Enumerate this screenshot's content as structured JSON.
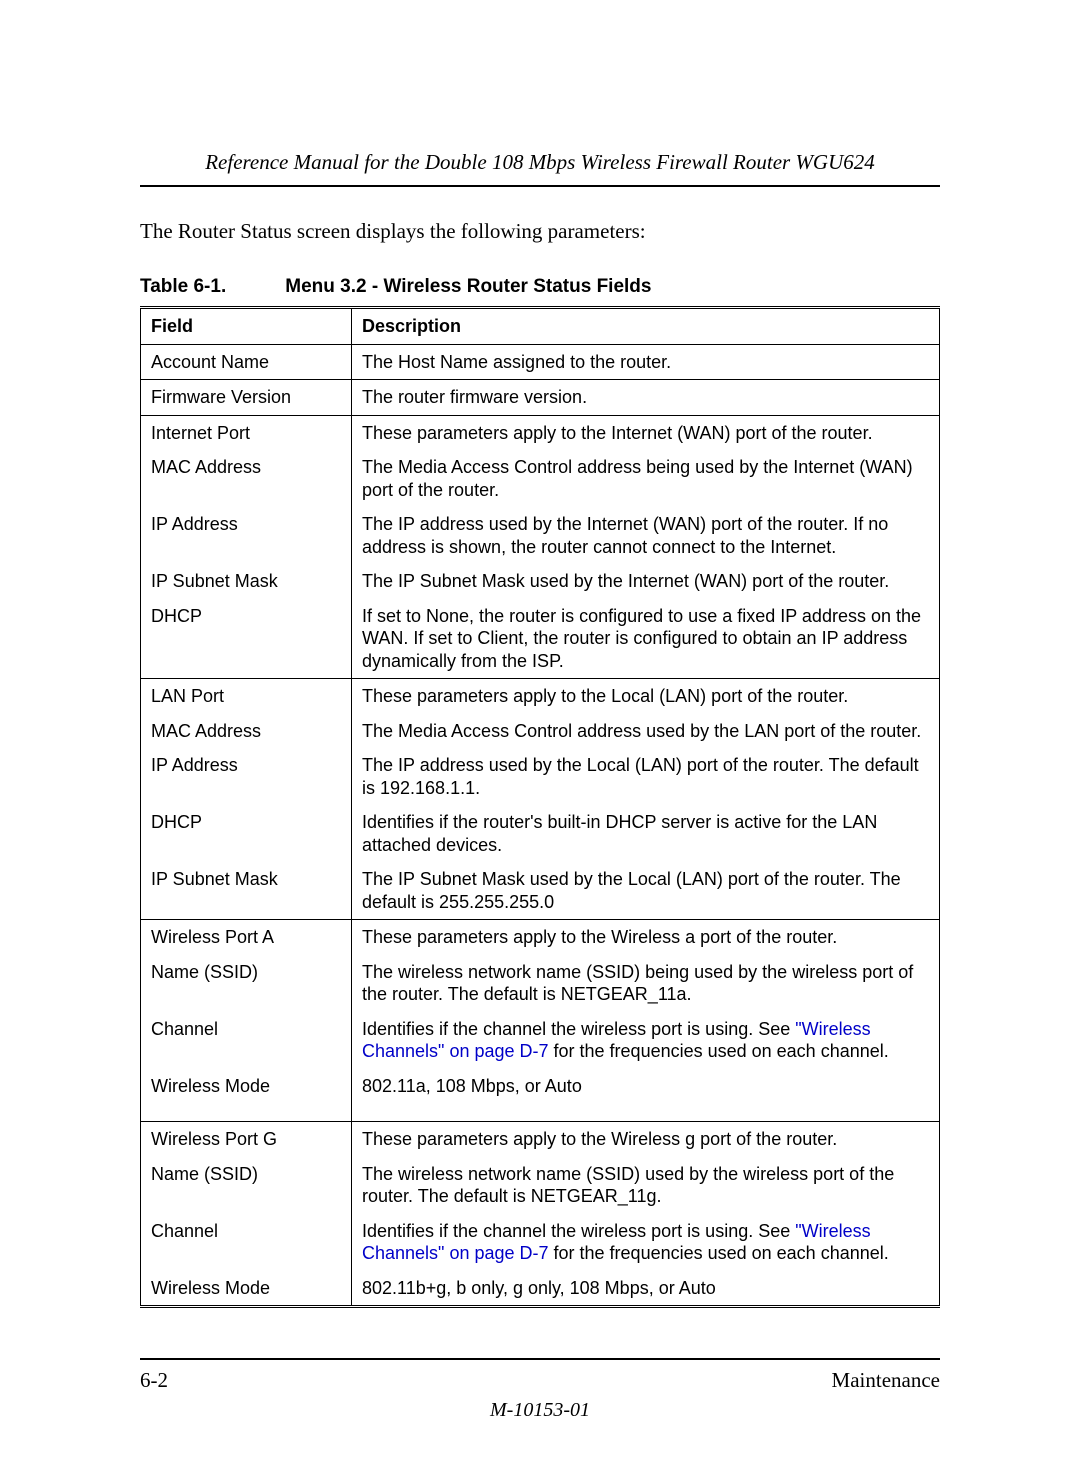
{
  "running_head": "Reference Manual for the Double 108 Mbps Wireless Firewall Router WGU624",
  "intro": "The Router Status screen displays the following parameters:",
  "caption_num": "Table 6-1.",
  "caption_title": "Menu 3.2 - Wireless Router Status Fields",
  "th_field": "Field",
  "th_desc": "Description",
  "rows": {
    "account_name": {
      "f": "Account Name",
      "d": "The Host Name assigned to the router."
    },
    "firmware": {
      "f": "Firmware Version",
      "d": "The router firmware version."
    },
    "internet_port": {
      "f": "Internet Port",
      "d": "These parameters apply to the Internet (WAN) port of the router."
    },
    "ip_mac": {
      "f": "MAC Address",
      "d": "The Media Access Control address being used by the Internet (WAN) port of the router."
    },
    "ip_ip": {
      "f": "IP Address",
      "d": "The IP address used by the Internet (WAN) port of the router. If no address is shown, the router cannot connect to the Internet."
    },
    "ip_subnet": {
      "f": "IP Subnet Mask",
      "d": "The IP Subnet Mask used by the Internet (WAN) port of the router."
    },
    "ip_dhcp": {
      "f": "DHCP",
      "d": "If set to None, the router is configured to use a fixed IP address on the WAN. If set to Client, the router is configured to obtain an IP address dynamically from the ISP."
    },
    "lan_port": {
      "f": "LAN Port",
      "d": "These parameters apply to the Local (LAN) port of the router."
    },
    "lan_mac": {
      "f": "MAC Address",
      "d": "The Media Access Control address used by the LAN port of the router."
    },
    "lan_ip": {
      "f": "IP Address",
      "d": "The IP address used by the Local (LAN) port of the router. The default is 192.168.1.1."
    },
    "lan_dhcp": {
      "f": "DHCP",
      "d": "Identifies if the router's built-in DHCP server is active for the LAN attached devices."
    },
    "lan_subnet": {
      "f": "IP Subnet Mask",
      "d": "The IP Subnet Mask used by the Local (LAN) port of the router. The default is 255.255.255.0"
    },
    "wpa": {
      "f": "Wireless Port A",
      "d": "These parameters apply to the Wireless a port of the router."
    },
    "wpa_ssid": {
      "f": "Name (SSID)",
      "d": "The wireless network name (SSID) being used by the wireless port of the router. The default is NETGEAR_11a."
    },
    "wpa_ch_pre": "Identifies if the channel the wireless port is using. See ",
    "wpa_ch_link": "\"Wireless Channels\" on page D-7",
    "wpa_ch_post": " for the frequencies used on each channel.",
    "wpa_ch_f": "Channel",
    "wpa_mode": {
      "f": "Wireless Mode",
      "d": "802.11a, 108 Mbps, or Auto"
    },
    "wpg": {
      "f": "Wireless Port G",
      "d": "These parameters apply to the Wireless g port of the router."
    },
    "wpg_ssid": {
      "f": "Name (SSID)",
      "d": "The wireless network name (SSID) used by the wireless port of the router. The default is NETGEAR_11g."
    },
    "wpg_ch_pre": "Identifies if the channel the wireless port is using. See ",
    "wpg_ch_link": "\"Wireless Channels\" on page D-7",
    "wpg_ch_post": " for the frequencies used on each channel.",
    "wpg_ch_f": "Channel",
    "wpg_mode": {
      "f": "Wireless Mode",
      "d": "802.11b+g, b only, g only, 108 Mbps, or Auto"
    }
  },
  "footer_left": "6-2",
  "footer_right": "Maintenance",
  "doc_id": "M-10153-01"
}
